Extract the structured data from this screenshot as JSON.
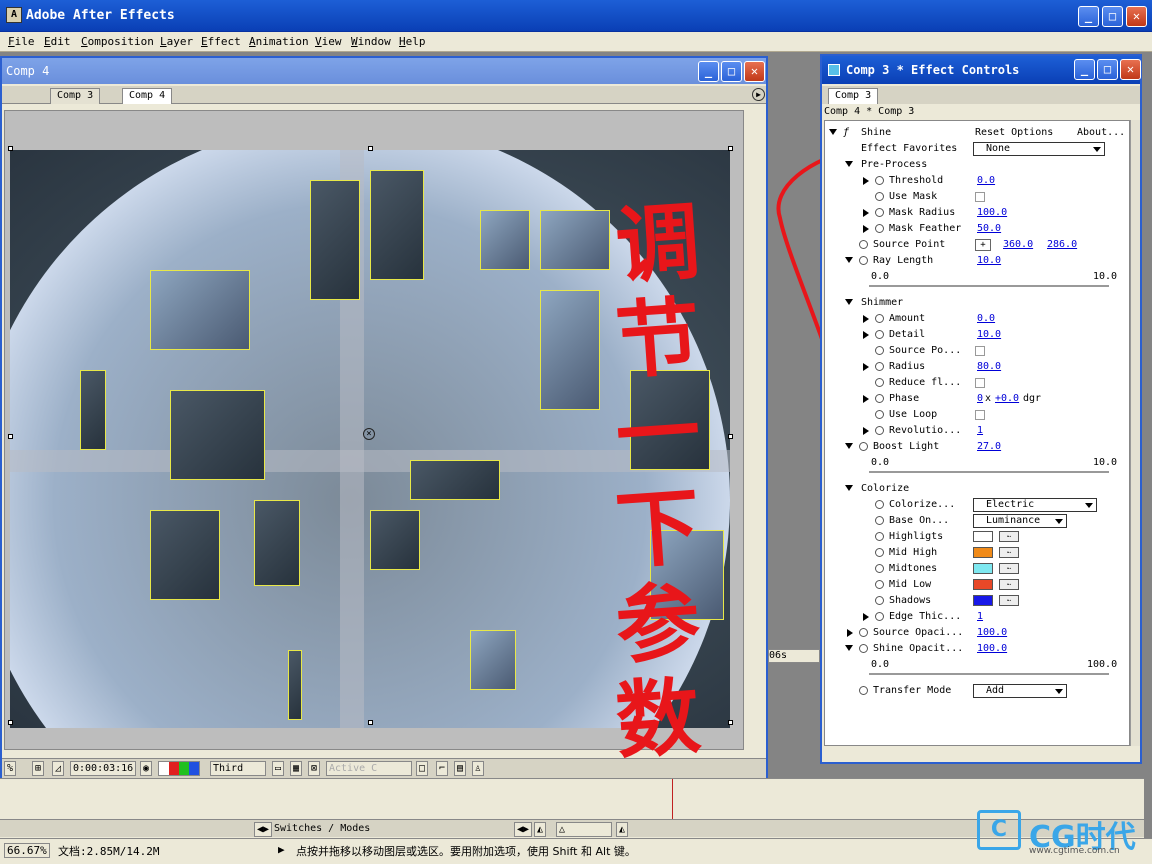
{
  "app": {
    "title": "Adobe After Effects",
    "logo": "A"
  },
  "menu": [
    "File",
    "Edit",
    "Composition",
    "Layer",
    "Effect",
    "Animation",
    "View",
    "Window",
    "Help"
  ],
  "comp_window": {
    "title": "Comp 4",
    "tabs": [
      "Comp 3",
      "Comp 4"
    ],
    "timecode": "0:00:03:16",
    "view_menu": "Third",
    "camera_menu": "Active C",
    "zoom_readout": "%"
  },
  "annotation": {
    "text": [
      "调",
      "节",
      "一",
      "下",
      "参",
      "数"
    ]
  },
  "effect_controls": {
    "title": "Comp 3 * Effect Controls",
    "tab": "Comp 3",
    "subtitle": "Comp 4 * Comp 3",
    "effect_name": "Shine",
    "reset": "Reset Options",
    "about": "About...",
    "favorites_label": "Effect Favorites",
    "favorites_value": "None",
    "rows": {
      "preprocess": "Pre-Process",
      "threshold": {
        "label": "Threshold",
        "value": "0.0"
      },
      "use_mask": "Use Mask",
      "mask_radius": {
        "label": "Mask Radius",
        "value": "100.0"
      },
      "mask_feather": {
        "label": "Mask Feather",
        "value": "50.0"
      },
      "source_point": {
        "label": "Source Point",
        "x": "360.0",
        "y": "286.0"
      },
      "ray_length": {
        "label": "Ray Length",
        "value": "10.0",
        "min": "0.0",
        "max": "10.0"
      },
      "shimmer": "Shimmer",
      "amount": {
        "label": "Amount",
        "value": "0.0"
      },
      "detail": {
        "label": "Detail",
        "value": "10.0"
      },
      "source_po": "Source Po...",
      "radius": {
        "label": "Radius",
        "value": "80.0"
      },
      "reduce": "Reduce fl...",
      "phase": {
        "label": "Phase",
        "rev": "0",
        "sep": "x",
        "deg": "+0.0",
        "unit": "dgr"
      },
      "use_loop": "Use Loop",
      "revolutions": {
        "label": "Revolutio...",
        "value": "1"
      },
      "boost_light": {
        "label": "Boost Light",
        "value": "27.0",
        "min": "0.0",
        "max": "10.0"
      },
      "colorize": "Colorize",
      "colorize_sel": {
        "label": "Colorize...",
        "value": "Electric"
      },
      "base_on": {
        "label": "Base On...",
        "value": "Luminance"
      },
      "highlights": {
        "label": "Highligts",
        "color": "#ffffff"
      },
      "mid_high": {
        "label": "Mid High",
        "color": "#f08a18"
      },
      "midtones": {
        "label": "Midtones",
        "color": "#7ee8f0"
      },
      "mid_low": {
        "label": "Mid Low",
        "color": "#e84828"
      },
      "shadows": {
        "label": "Shadows",
        "color": "#1818e8"
      },
      "edge_thickness": {
        "label": "Edge Thic...",
        "value": "1"
      },
      "source_opacity": {
        "label": "Source Opaci...",
        "value": "100.0"
      },
      "shine_opacity": {
        "label": "Shine Opacit...",
        "value": "100.0",
        "min": "0.0",
        "max": "100.0"
      },
      "transfer_mode": {
        "label": "Transfer Mode",
        "value": "Add"
      }
    }
  },
  "timeline": {
    "switches": "Switches / Modes",
    "time_partial": "06s"
  },
  "status": {
    "zoom": "66.67%",
    "doc": "文档:2.85M/14.2M",
    "hint": "点按并拖移以移动图层或选区。要用附加选项，使用 Shift 和 Alt 键。"
  },
  "watermark": {
    "brand": "CG时代",
    "url": "www.cgtime.com.cn"
  }
}
